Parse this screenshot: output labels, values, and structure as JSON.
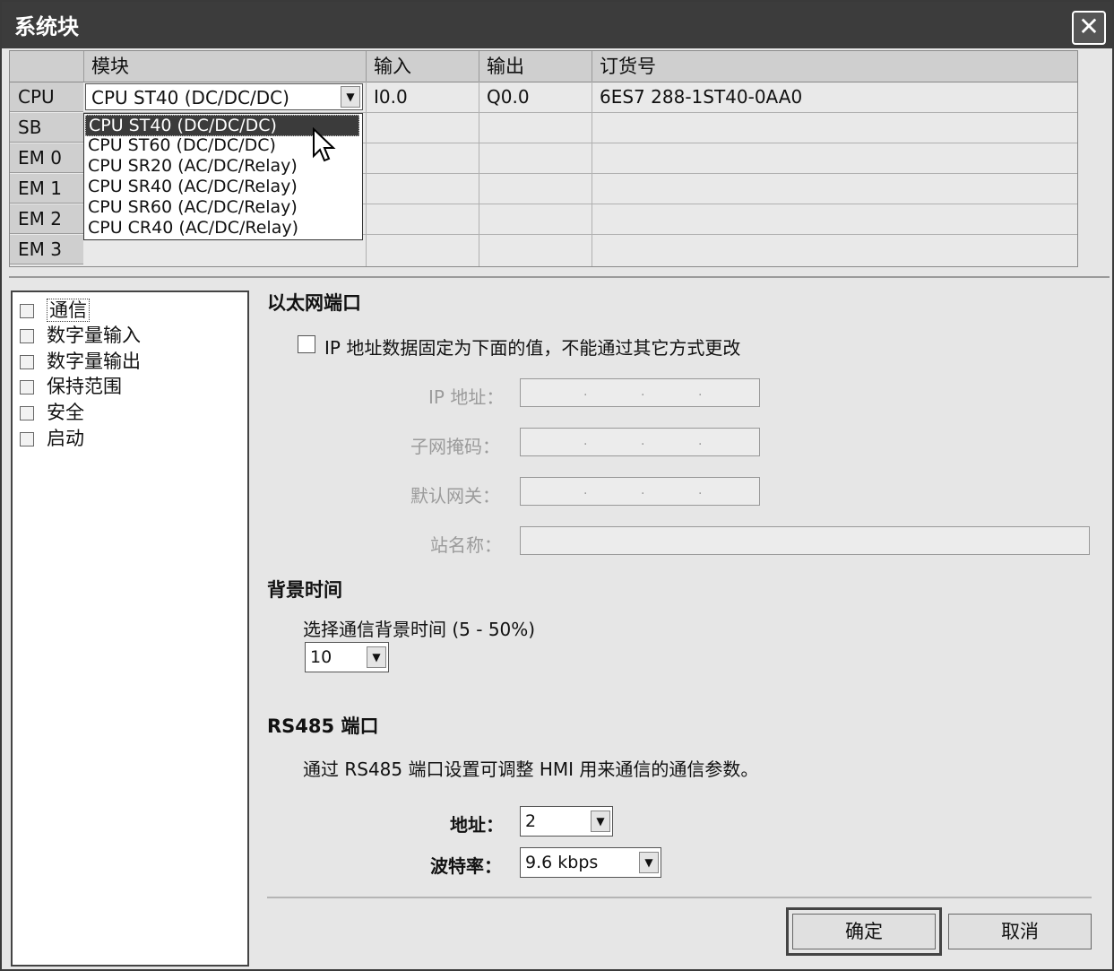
{
  "window": {
    "title": "系统块",
    "close_glyph": "✕"
  },
  "grid": {
    "headers": [
      "模块",
      "输入",
      "输出",
      "订货号"
    ],
    "rows": [
      "CPU",
      "SB",
      "EM 0",
      "EM 1",
      "EM 2",
      "EM 3"
    ],
    "cpu_row": {
      "module": "CPU ST40 (DC/DC/DC)",
      "input": "I0.0",
      "output": "Q0.0",
      "order_no": "6ES7 288-1ST40-0AA0"
    },
    "dropdown_options": [
      "CPU ST40 (DC/DC/DC)",
      "CPU ST60 (DC/DC/DC)",
      "CPU SR20 (AC/DC/Relay)",
      "CPU SR40 (AC/DC/Relay)",
      "CPU SR60 (AC/DC/Relay)",
      "CPU CR40 (AC/DC/Relay)"
    ]
  },
  "tree": {
    "items": [
      "通信",
      "数字量输入",
      "数字量输出",
      "保持范围",
      "安全",
      "启动"
    ]
  },
  "ethernet": {
    "title": "以太网端口",
    "fixed_ip_label": "IP 地址数据固定为下面的值，不能通过其它方式更改",
    "ip_label": "IP 地址：",
    "subnet_label": "子网掩码：",
    "gateway_label": "默认网关：",
    "station_label": "站名称："
  },
  "background_time": {
    "title": "背景时间",
    "desc": "选择通信背景时间 (5 - 50%)",
    "value": "10"
  },
  "rs485": {
    "title": "RS485  端口",
    "desc": "通过 RS485 端口设置可调整 HMI 用来通信的通信参数。",
    "address_label": "地址：",
    "address_value": "2",
    "baud_label": "波特率：",
    "baud_value": "9.6 kbps"
  },
  "buttons": {
    "ok": "确定",
    "cancel": "取消"
  }
}
